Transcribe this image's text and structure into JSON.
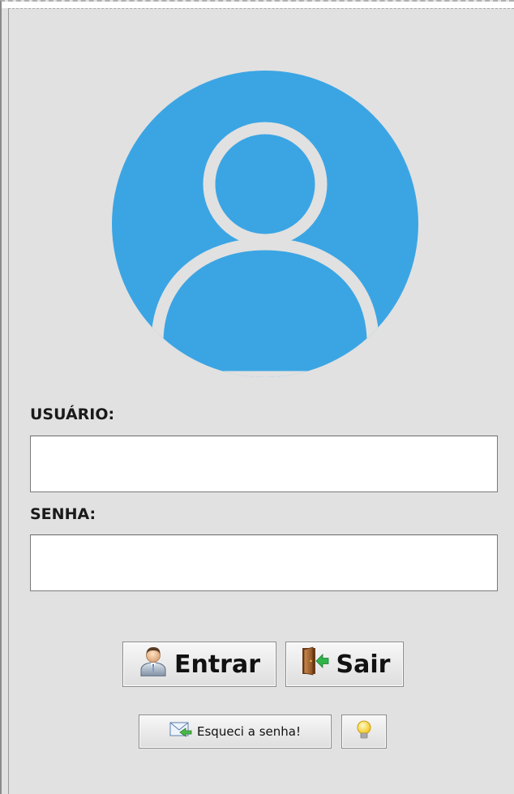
{
  "login": {
    "avatar_icon": "user-avatar-icon",
    "accent_color": "#3ba5e4",
    "username": {
      "label": "USUÁRIO:",
      "value": ""
    },
    "password": {
      "label": "SENHA:",
      "value": ""
    },
    "buttons": {
      "enter": {
        "label": "Entrar",
        "icon": "user-icon"
      },
      "exit": {
        "label": "Sair",
        "icon": "exit-door-icon"
      },
      "forgot": {
        "label": "Esqueci a senha!",
        "icon": "mail-forward-icon"
      },
      "hint": {
        "icon": "lightbulb-icon"
      }
    }
  }
}
